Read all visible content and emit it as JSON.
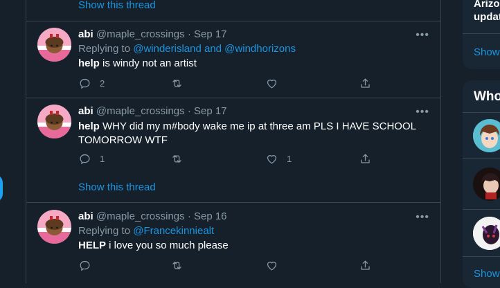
{
  "feed": {
    "top_show_thread": "Show this thread",
    "tweets": [
      {
        "name": "abi",
        "handle": "@maple_crossings",
        "dot": "·",
        "date": "Sep 17",
        "replying_prefix": "Replying to",
        "replying_users": "@winderisland and @windhorizons",
        "text_bold": "help",
        "text_rest": " is windy not an artist",
        "reply_count": "2",
        "retweet_count": "",
        "like_count": ""
      },
      {
        "name": "abi",
        "handle": "@maple_crossings",
        "dot": "·",
        "date": "Sep 17",
        "text_bold": "help",
        "text_rest": " WHY did my m#body wake me ip at three am PLS I HAVE SCHOOL TOMORROW WTF",
        "reply_count": "1",
        "retweet_count": "",
        "like_count": "1",
        "show_thread": "Show this thread"
      },
      {
        "name": "abi",
        "handle": "@maple_crossings",
        "dot": "·",
        "date": "Sep 16",
        "replying_prefix": "Replying to",
        "replying_users": "@Francekinniealt",
        "text_bold": "HELP",
        "text_rest": " i love you so much please",
        "reply_count": "",
        "retweet_count": "",
        "like_count": ""
      }
    ]
  },
  "sidebar": {
    "trend_text_line1": "Arizo",
    "trend_text_line2": "updat",
    "show_more_1": "Show",
    "who_to_follow_heading": "Who",
    "show_more_2": "Show"
  },
  "icons": {
    "more": "more-horizontal-icon",
    "reply": "reply-icon",
    "retweet": "retweet-icon",
    "like": "heart-icon",
    "share": "share-icon"
  },
  "colors": {
    "background": "#15202b",
    "card": "#192734",
    "border": "#38444d",
    "link": "#1b95e0",
    "muted": "#8899a6",
    "accent": "#1da1f2"
  }
}
